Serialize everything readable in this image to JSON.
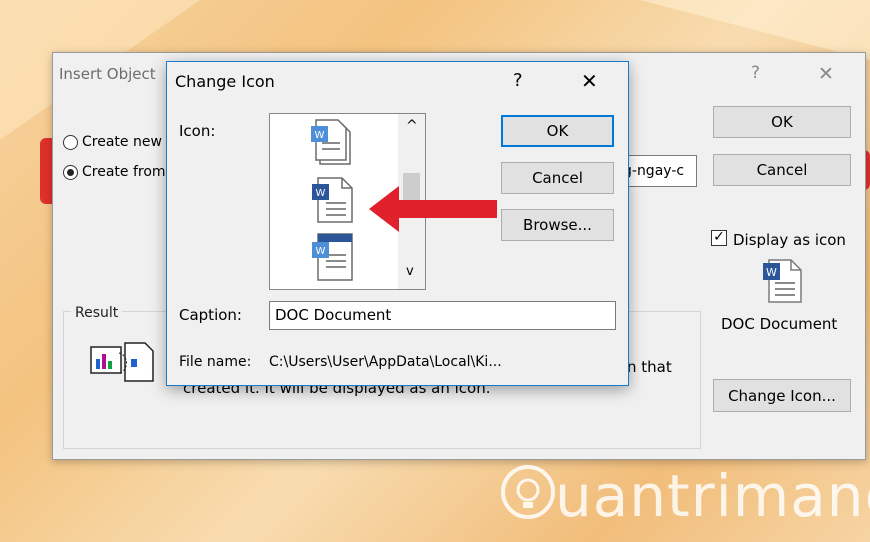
{
  "background": {
    "watermark": "uantrimang"
  },
  "insert_object": {
    "title": "Insert Object",
    "help_glyph": "?",
    "close_glyph": "✕",
    "options": [
      {
        "label": "Create new",
        "checked": false
      },
      {
        "label": "Create from",
        "checked": true
      }
    ],
    "file_value": "g-ngay-c",
    "ok_label": "OK",
    "cancel_label": "Cancel",
    "display_as_icon": {
      "label": "Display as icon",
      "checked": true
    },
    "icon_caption": "DOC Document",
    "change_icon_label": "Change Icon...",
    "result": {
      "label": "Result",
      "line1_tail": "n that",
      "line2": "created it. It will be displayed as an icon."
    }
  },
  "change_icon": {
    "title": "Change Icon",
    "help_glyph": "?",
    "close_glyph": "✕",
    "icon_label": "Icon:",
    "ok_label": "OK",
    "cancel_label": "Cancel",
    "browse_label": "Browse...",
    "caption_label": "Caption:",
    "caption_value": "DOC Document",
    "file_name_label": "File name:",
    "file_name_value": "C:\\Users\\User\\AppData\\Local\\Ki...",
    "scroll_up_glyph": "^",
    "scroll_down_glyph": "v"
  },
  "colors": {
    "accent": "#0078d7",
    "word_blue": "#2b579a",
    "arrow_red": "#e0202a"
  }
}
